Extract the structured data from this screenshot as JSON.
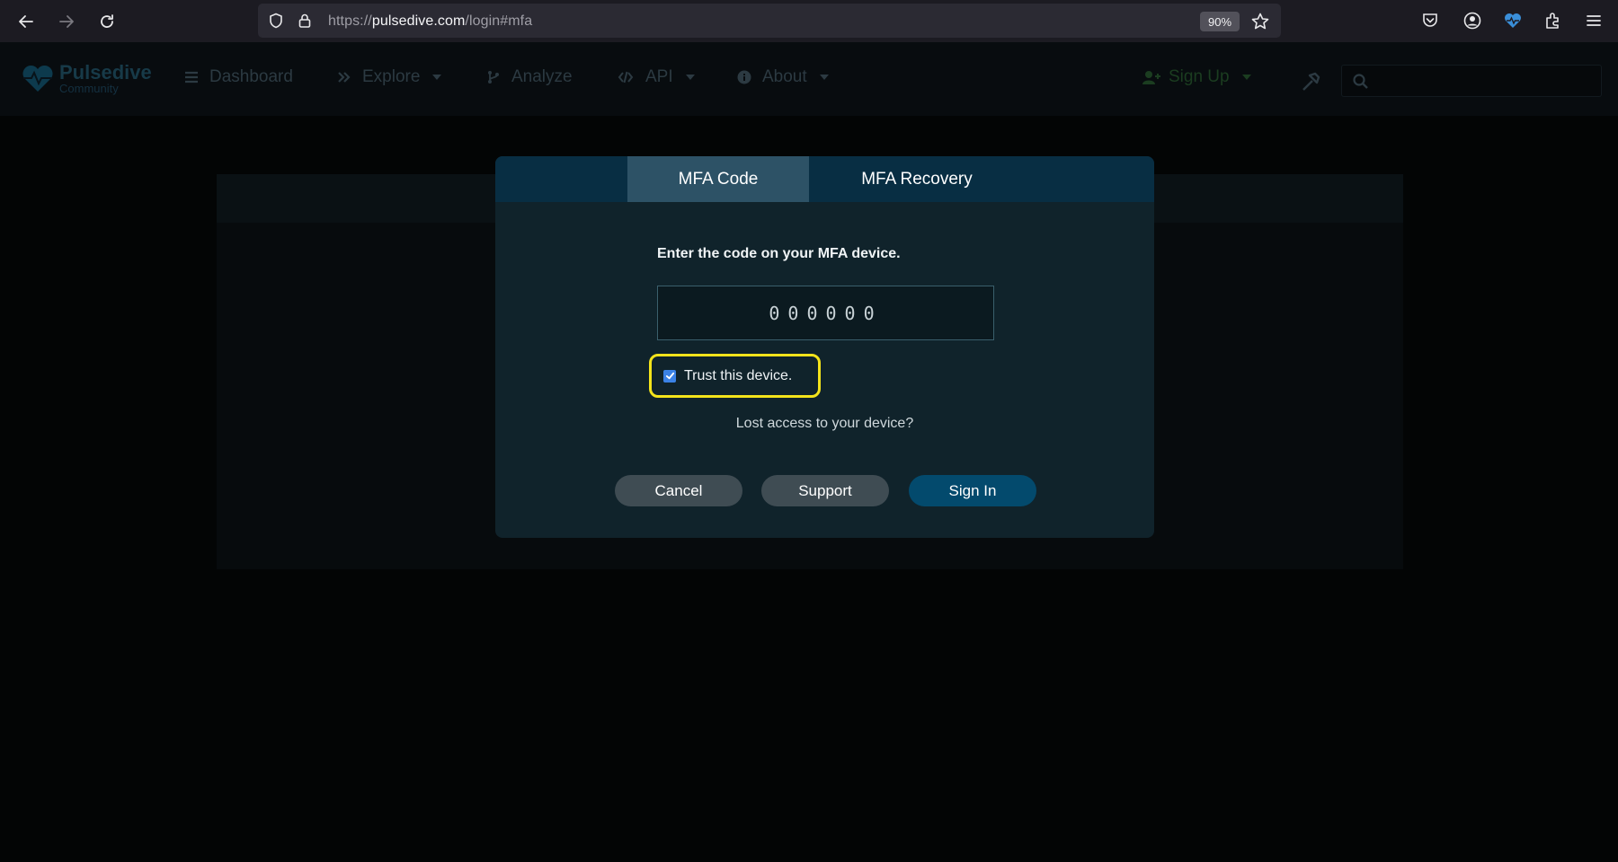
{
  "browser": {
    "url_prefix": "https://",
    "url_host": "pulsedive.com",
    "url_path": "/login#mfa",
    "zoom": "90%"
  },
  "site": {
    "logo_name": "Pulsedive",
    "logo_sub": "Community",
    "nav": {
      "dashboard": "Dashboard",
      "explore": "Explore",
      "analyze": "Analyze",
      "api": "API",
      "about": "About",
      "signup": "Sign Up"
    },
    "search_placeholder": ""
  },
  "modal": {
    "tabs": [
      "MFA Code",
      "MFA Recovery"
    ],
    "active_tab": 0,
    "prompt": "Enter the code on your MFA device.",
    "code_placeholder": "000000",
    "trust_label": "Trust this device.",
    "trust_checked": true,
    "lost_link": "Lost access to your device?",
    "buttons": {
      "cancel": "Cancel",
      "support": "Support",
      "signin": "Sign In"
    }
  },
  "colors": {
    "highlight": "#f3e31b",
    "primary_button": "#034a6d",
    "active_tab": "#2d5266"
  }
}
